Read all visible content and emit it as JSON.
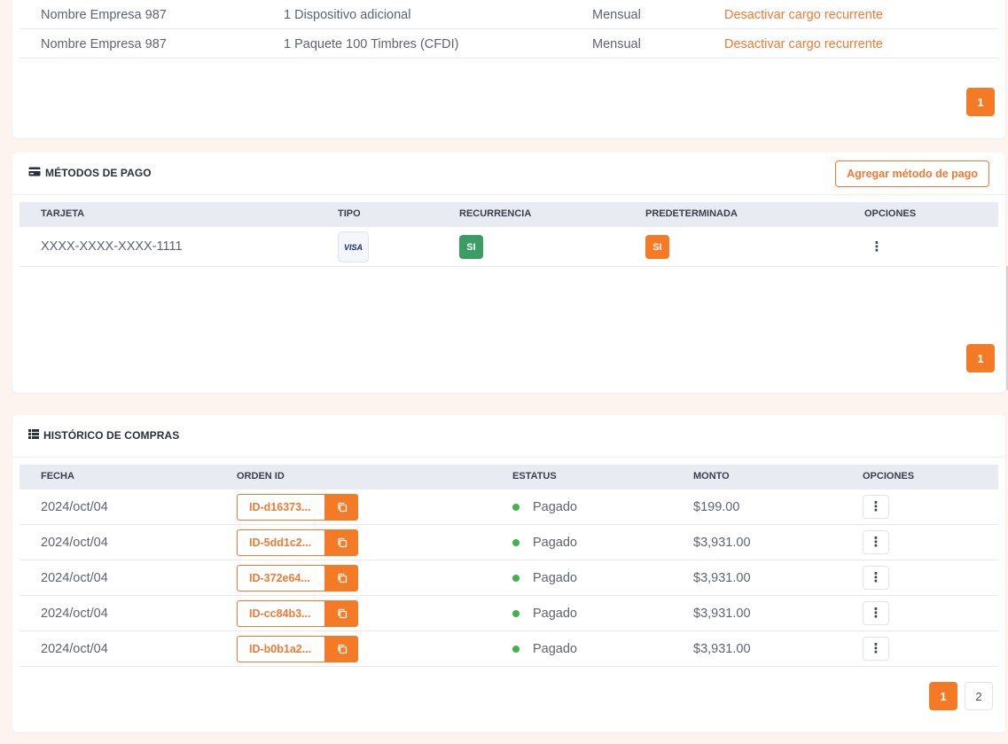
{
  "recurring": {
    "rows": [
      {
        "company": "Nombre Empresa 987",
        "product": "1 Dispositivo adicional",
        "period": "Mensual",
        "action": "Desactivar cargo recurrente"
      },
      {
        "company": "Nombre Empresa 987",
        "product": "1 Paquete 100 Timbres (CFDI)",
        "period": "Mensual",
        "action": "Desactivar cargo recurrente"
      }
    ],
    "page": "1"
  },
  "payments": {
    "title": "MÉTODOS DE PAGO",
    "add_button": "Agregar método de pago",
    "headers": {
      "card": "TARJETA",
      "type": "TIPO",
      "recurrence": "RECURRENCIA",
      "default": "PREDETERMINADA",
      "options": "OPCIONES"
    },
    "rows": [
      {
        "card": "XXXX-XXXX-XXXX-1111",
        "type": "VISA",
        "recurrence": "SI",
        "default": "SI"
      }
    ],
    "page": "1"
  },
  "history": {
    "title": "HISTÓRICO DE COMPRAS",
    "headers": {
      "date": "FECHA",
      "order": "ORDEN ID",
      "status": "ESTATUS",
      "amount": "MONTO",
      "options": "OPCIONES"
    },
    "rows": [
      {
        "date": "2024/oct/04",
        "order": "ID-d16373...",
        "status": "Pagado",
        "amount": "$199.00"
      },
      {
        "date": "2024/oct/04",
        "order": "ID-5dd1c2...",
        "status": "Pagado",
        "amount": "$3,931.00"
      },
      {
        "date": "2024/oct/04",
        "order": "ID-372e64...",
        "status": "Pagado",
        "amount": "$3,931.00"
      },
      {
        "date": "2024/oct/04",
        "order": "ID-cc84b3...",
        "status": "Pagado",
        "amount": "$3,931.00"
      },
      {
        "date": "2024/oct/04",
        "order": "ID-b0b1a2...",
        "status": "Pagado",
        "amount": "$3,931.00"
      }
    ],
    "pages": [
      "1",
      "2"
    ]
  },
  "colors": {
    "accent": "#f47a25",
    "success": "#3a9d64",
    "status_paid": "#3db54a"
  },
  "icons": {
    "payments_title": "credit-card-icon",
    "history_title": "list-icon",
    "copy": "copy-icon",
    "options": "kebab-menu-icon"
  }
}
